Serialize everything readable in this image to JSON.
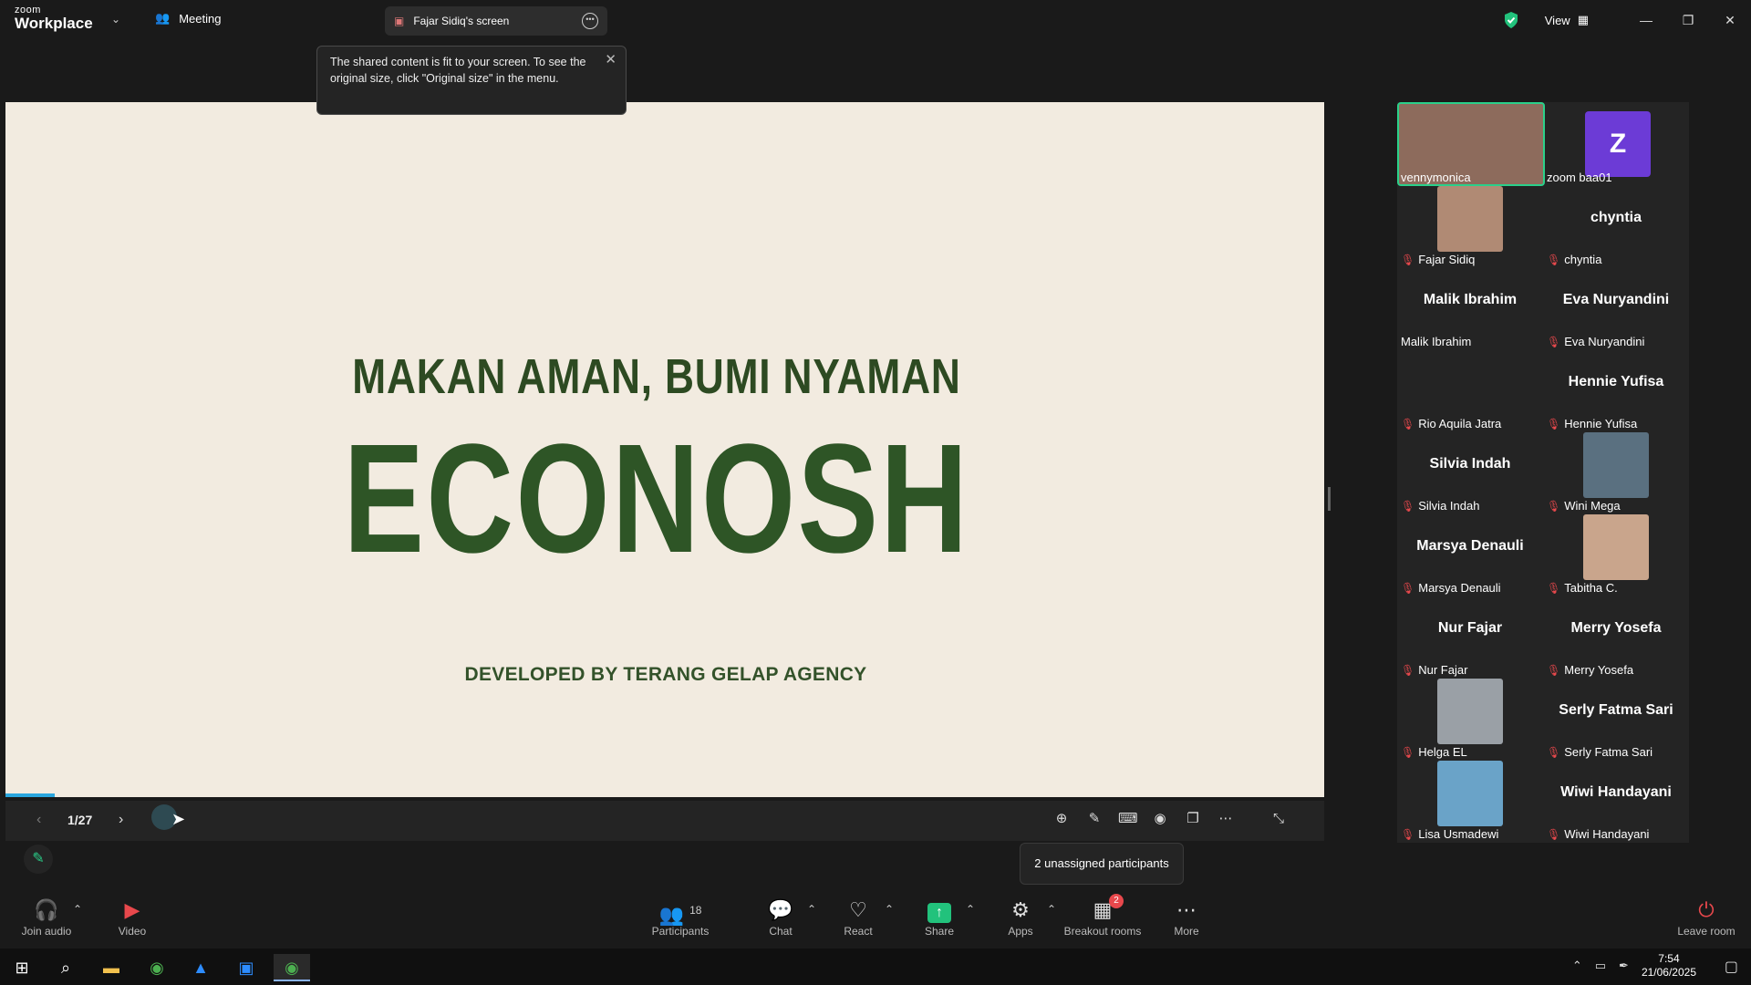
{
  "app": {
    "brand_small": "zoom",
    "brand_large": "Workplace",
    "meeting_tab": "Meeting",
    "shared_screen_tab": "Fajar Sidiq's screen",
    "view_label": "View"
  },
  "tooltip": {
    "text": "The shared content is fit to your screen. To see the original size, click \"Original size\" in the menu."
  },
  "slide": {
    "tagline": "MAKAN AMAN, BUMI NYAMAN",
    "title": "ECONOSH",
    "developer": "DEVELOPED BY TERANG GELAP AGENCY",
    "page_indicator": "1/27",
    "progress": 0.037
  },
  "gallery": {
    "participants": [
      {
        "name": "vennymonica",
        "display": "",
        "muted": false,
        "video": true
      },
      {
        "name": "zoom baa01",
        "display": "Z",
        "muted": false,
        "video": false
      },
      {
        "name": "Fajar Sidiq",
        "display": "",
        "muted": true,
        "video": true
      },
      {
        "name": "chyntia",
        "display": "chyntia",
        "muted": true,
        "video": false
      },
      {
        "name": "Malik Ibrahim",
        "display": "Malik Ibrahim",
        "muted": false,
        "video": false
      },
      {
        "name": "Eva Nuryandini",
        "display": "Eva Nuryandini",
        "muted": true,
        "video": false
      },
      {
        "name": "Rio Aquila Jatra",
        "display": "",
        "muted": true,
        "video": false
      },
      {
        "name": "Hennie Yufisa",
        "display": "Hennie Yufisa",
        "muted": true,
        "video": false
      },
      {
        "name": "Silvia Indah",
        "display": "Silvia Indah",
        "muted": true,
        "video": false
      },
      {
        "name": "Wini Mega",
        "display": "",
        "muted": true,
        "video": true
      },
      {
        "name": "Marsya Denauli",
        "display": "Marsya Denauli",
        "muted": true,
        "video": false
      },
      {
        "name": "Tabitha C.",
        "display": "",
        "muted": true,
        "video": true
      },
      {
        "name": "Nur Fajar",
        "display": "Nur Fajar",
        "muted": true,
        "video": false
      },
      {
        "name": "Merry Yosefa",
        "display": "Merry Yosefa",
        "muted": true,
        "video": false
      },
      {
        "name": "Helga EL",
        "display": "",
        "muted": true,
        "video": true
      },
      {
        "name": "Serly Fatma Sari",
        "display": "Serly Fatma Sari",
        "muted": true,
        "video": false
      },
      {
        "name": "Lisa Usmadewi",
        "display": "",
        "muted": true,
        "video": true
      },
      {
        "name": "Wiwi Handayani",
        "display": "Wiwi Handayani",
        "muted": true,
        "video": false
      }
    ]
  },
  "unassigned_tooltip": "2 unassigned participants",
  "toolbar": {
    "join_audio": "Join audio",
    "video": "Video",
    "participants": "Participants",
    "participant_count": "18",
    "chat": "Chat",
    "react": "React",
    "share": "Share",
    "apps": "Apps",
    "breakout_rooms": "Breakout rooms",
    "breakout_badge": "2",
    "more": "More",
    "leave_room": "Leave room"
  },
  "taskbar": {
    "time": "7:54",
    "date": "21/06/2025"
  },
  "colors": {
    "accent_green": "#2ad08a",
    "slide_bg": "#f2ebe0",
    "slide_text": "#2e5526",
    "muted_red": "#e8484c",
    "share_green": "#22c27c",
    "avatar_purple": "#6c3bd6"
  }
}
